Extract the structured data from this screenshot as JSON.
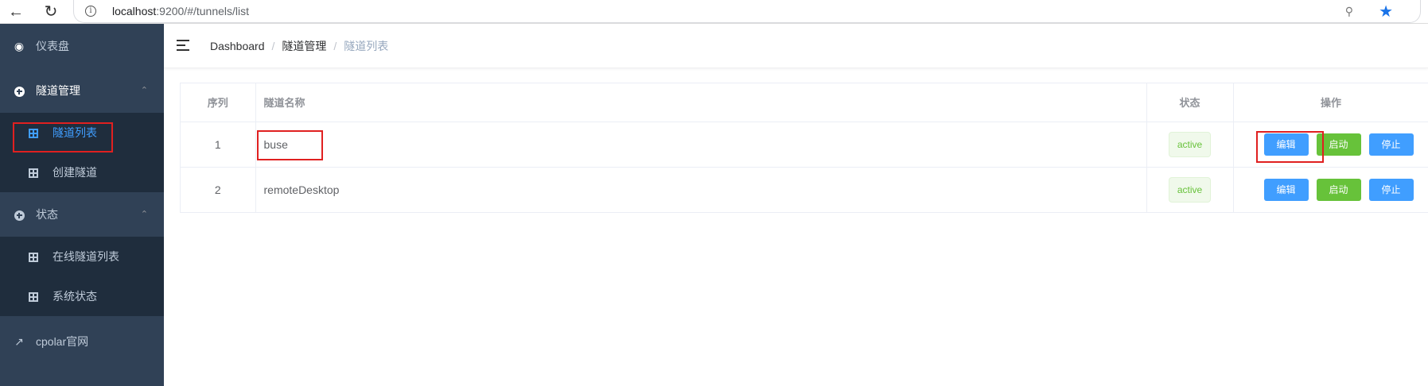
{
  "browser": {
    "url_host": "localhost",
    "url_path": ":9200/#/tunnels/list"
  },
  "sidebar": {
    "dashboard": "仪表盘",
    "tunnel_mgmt": "隧道管理",
    "tunnel_list": "隧道列表",
    "create_tunnel": "创建隧道",
    "status": "状态",
    "online_tunnels": "在线隧道列表",
    "system_status": "系统状态",
    "official_site": "cpolar官网"
  },
  "breadcrumb": {
    "home": "Dashboard",
    "section": "隧道管理",
    "current": "隧道列表",
    "separator": "/"
  },
  "table": {
    "headers": [
      "序列",
      "隧道名称",
      "状态",
      "操作"
    ],
    "rows": [
      {
        "index": "1",
        "name": "buse",
        "status": "active",
        "edit": "编辑",
        "start": "启动",
        "stop": "停止"
      },
      {
        "index": "2",
        "name": "remoteDesktop",
        "status": "active",
        "edit": "编辑",
        "start": "启动",
        "stop": "停止"
      }
    ]
  },
  "colors": {
    "sidebar_bg": "#304156",
    "submenu_bg": "#1f2d3d",
    "active_blue": "#409eff",
    "success_green": "#67c23a",
    "highlight_red": "#e02020"
  }
}
